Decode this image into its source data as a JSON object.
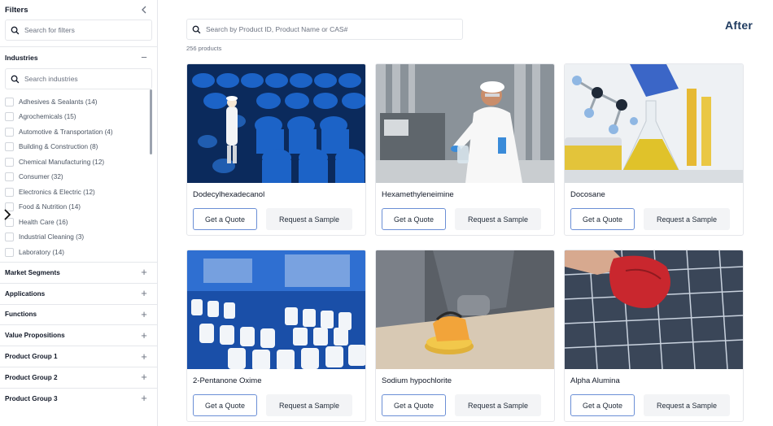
{
  "sidebar": {
    "title": "Filters",
    "search_placeholder": "Search for filters",
    "industries": {
      "title": "Industries",
      "search_placeholder": "Search industries",
      "items": [
        {
          "label": "Adhesives & Sealants (14)"
        },
        {
          "label": "Agrochemicals (15)"
        },
        {
          "label": "Automotive & Transportation (4)"
        },
        {
          "label": "Building & Construction (8)"
        },
        {
          "label": "Chemical Manufacturing (12)"
        },
        {
          "label": "Consumer (32)"
        },
        {
          "label": "Electronics & Electric (12)"
        },
        {
          "label": "Food & Nutrition (14)"
        },
        {
          "label": "Health Care (16)"
        },
        {
          "label": "Industrial Cleaning (3)"
        },
        {
          "label": "Laboratory (14)"
        }
      ]
    },
    "sections": [
      {
        "label": "Market Segments"
      },
      {
        "label": "Applications"
      },
      {
        "label": "Functions"
      },
      {
        "label": "Value Propositions"
      },
      {
        "label": "Product Group 1"
      },
      {
        "label": "Product Group 2"
      },
      {
        "label": "Product Group 3"
      }
    ]
  },
  "main": {
    "search_placeholder": "Search by Product ID, Product Name or CAS#",
    "count_text": "256 products",
    "badge": "After",
    "quote_label": "Get a Quote",
    "sample_label": "Request a Sample",
    "products": [
      {
        "name": "Dodecylhexadecanol",
        "image": "blue-drums-warehouse-photo"
      },
      {
        "name": "Hexamethyleneimine",
        "image": "lab-technician-photo"
      },
      {
        "name": "Docosane",
        "image": "flasks-molecule-photo"
      },
      {
        "name": "2-Pentanone Oxime",
        "image": "bottle-production-line-photo"
      },
      {
        "name": "Sodium hypochlorite",
        "image": "sanding-worker-photo"
      },
      {
        "name": "Alpha Alumina",
        "image": "solar-panel-cleaning-photo"
      }
    ]
  },
  "colors": {
    "accent_border": "#6b8fd6",
    "badge": "#1e3a5f",
    "sample_bg": "#f3f4f6"
  }
}
